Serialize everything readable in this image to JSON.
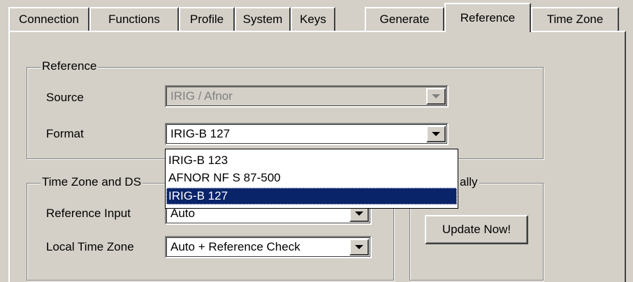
{
  "tabs": [
    {
      "label": "Connection"
    },
    {
      "label": "Functions"
    },
    {
      "label": "Profile"
    },
    {
      "label": "System"
    },
    {
      "label": "Keys"
    },
    {
      "label": "Generate"
    },
    {
      "label": "Reference",
      "active": true
    },
    {
      "label": "Time Zone"
    }
  ],
  "reference_group": {
    "title": "Reference",
    "source_label": "Source",
    "source_value": "IRIG / Afnor",
    "format_label": "Format",
    "format_value": "IRIG-B 127"
  },
  "format_dropdown": {
    "options": [
      "IRIG-B 123",
      "AFNOR NF S 87-500",
      "IRIG-B 127"
    ],
    "selected": "IRIG-B 127"
  },
  "timezone_group": {
    "title_visible": "Time Zone and DS",
    "reference_input_label": "Reference Input",
    "reference_input_value": "Auto",
    "local_time_zone_label": "Local Time Zone",
    "local_time_zone_value": "Auto + Reference Check"
  },
  "update_group": {
    "title_visible": "ally",
    "update_button_label": "Update Now!"
  },
  "colors": {
    "face": "#d4d0c8",
    "highlight": "#0a246a",
    "disabled_text": "#808080"
  }
}
